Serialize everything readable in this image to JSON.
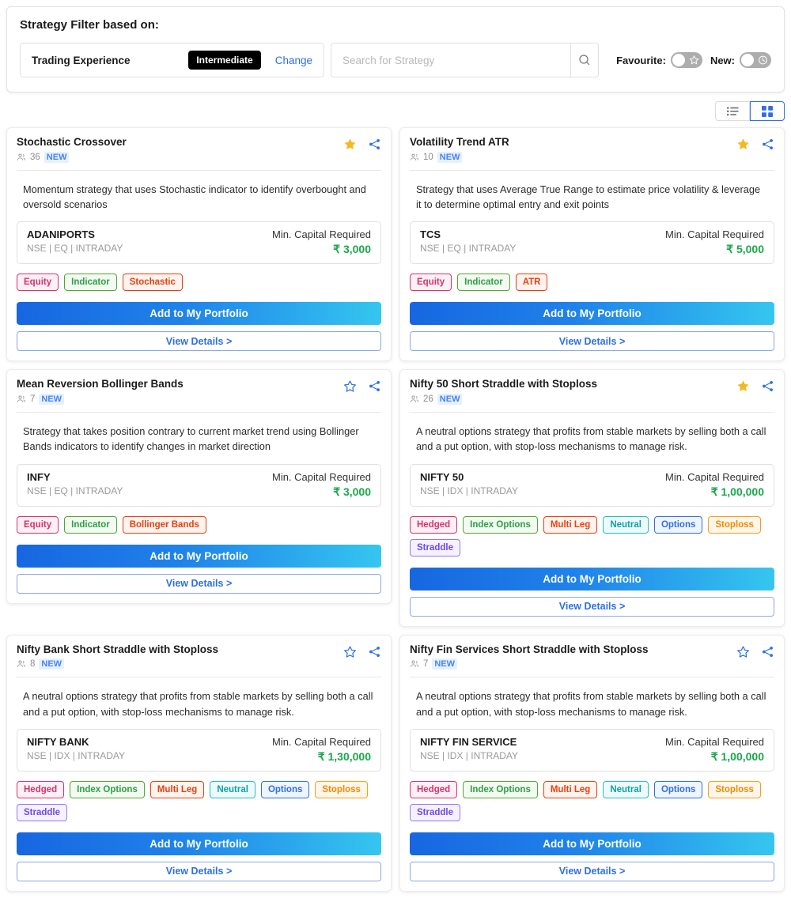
{
  "filter": {
    "title": "Strategy Filter based on:",
    "experience_label": "Trading Experience",
    "experience_value": "Intermediate",
    "change_link": "Change",
    "search_placeholder": "Search for Strategy",
    "search_value": "",
    "favourite_label": "Favourite:",
    "favourite_on": false,
    "new_label": "New:",
    "new_on": false
  },
  "view_toggle": {
    "list_label": "list-view",
    "grid_label": "grid-view",
    "active": "grid"
  },
  "labels": {
    "min_capital": "Min. Capital Required",
    "add_to_portfolio": "Add to My Portfolio",
    "view_details": "View Details >",
    "new_badge": "NEW"
  },
  "colors": {
    "accent_blue": "#2f6fe4",
    "green_value": "#1aa84a",
    "star_filled": "#f5b820",
    "gradient_start": "#1767e0",
    "gradient_end": "#35c6ef"
  },
  "cards": [
    {
      "title": "Stochastic Crossover",
      "users": "36",
      "new": "NEW",
      "favourite": true,
      "description": "Momentum strategy that uses Stochastic indicator to identify overbought and oversold scenarios",
      "instrument": "ADANIPORTS",
      "segment": "NSE | EQ | INTRADAY",
      "capital_label": "Min. Capital Required",
      "capital": "₹ 3,000",
      "tags": [
        {
          "label": "Equity",
          "color": "pink"
        },
        {
          "label": "Indicator",
          "color": "green"
        },
        {
          "label": "Stochastic",
          "color": "red"
        }
      ]
    },
    {
      "title": "Volatility Trend ATR",
      "users": "10",
      "new": "NEW",
      "favourite": true,
      "description": "Strategy that uses Average True Range to estimate price volatility & leverage it to determine optimal entry and exit points",
      "instrument": "TCS",
      "segment": "NSE | EQ | INTRADAY",
      "capital_label": "Min. Capital Required",
      "capital": "₹ 5,000",
      "tags": [
        {
          "label": "Equity",
          "color": "pink"
        },
        {
          "label": "Indicator",
          "color": "green"
        },
        {
          "label": "ATR",
          "color": "red"
        }
      ]
    },
    {
      "title": "Mean Reversion Bollinger Bands",
      "users": "7",
      "new": "NEW",
      "favourite": false,
      "description": "Strategy that takes position contrary to current market trend using Bollinger Bands indicators to identify changes in market direction",
      "instrument": "INFY",
      "segment": "NSE | EQ | INTRADAY",
      "capital_label": "Min. Capital Required",
      "capital": "₹ 3,000",
      "tags": [
        {
          "label": "Equity",
          "color": "pink"
        },
        {
          "label": "Indicator",
          "color": "green"
        },
        {
          "label": "Bollinger Bands",
          "color": "red"
        }
      ]
    },
    {
      "title": "Nifty 50 Short Straddle with Stoploss",
      "users": "26",
      "new": "NEW",
      "favourite": true,
      "description": "A neutral options strategy that profits from stable markets by selling both a call and a put option, with stop-loss mechanisms to manage risk.",
      "instrument": "NIFTY 50",
      "segment": "NSE | IDX | INTRADAY",
      "capital_label": "Min. Capital Required",
      "capital": "₹ 1,00,000",
      "tags": [
        {
          "label": "Hedged",
          "color": "pink"
        },
        {
          "label": "Index Options",
          "color": "green"
        },
        {
          "label": "Multi Leg",
          "color": "red"
        },
        {
          "label": "Neutral",
          "color": "teal"
        },
        {
          "label": "Options",
          "color": "blue"
        },
        {
          "label": "Stoploss",
          "color": "orange"
        },
        {
          "label": "Straddle",
          "color": "purple"
        }
      ]
    },
    {
      "title": "Nifty Bank Short Straddle with Stoploss",
      "users": "8",
      "new": "NEW",
      "favourite": false,
      "description": "A neutral options strategy that profits from stable markets by selling both a call and a put option, with stop-loss mechanisms to manage risk.",
      "instrument": "NIFTY BANK",
      "segment": "NSE | IDX | INTRADAY",
      "capital_label": "Min. Capital Required",
      "capital": "₹ 1,30,000",
      "tags": [
        {
          "label": "Hedged",
          "color": "pink"
        },
        {
          "label": "Index Options",
          "color": "green"
        },
        {
          "label": "Multi Leg",
          "color": "red"
        },
        {
          "label": "Neutral",
          "color": "teal"
        },
        {
          "label": "Options",
          "color": "blue"
        },
        {
          "label": "Stoploss",
          "color": "orange"
        },
        {
          "label": "Straddle",
          "color": "purple"
        }
      ]
    },
    {
      "title": "Nifty Fin Services Short Straddle with Stoploss",
      "users": "7",
      "new": "NEW",
      "favourite": false,
      "description": "A neutral options strategy that profits from stable markets by selling both a call and a put option, with stop-loss mechanisms to manage risk.",
      "instrument": "NIFTY FIN SERVICE",
      "segment": "NSE | IDX | INTRADAY",
      "capital_label": "Min. Capital Required",
      "capital": "₹ 1,00,000",
      "tags": [
        {
          "label": "Hedged",
          "color": "pink"
        },
        {
          "label": "Index Options",
          "color": "green"
        },
        {
          "label": "Multi Leg",
          "color": "red"
        },
        {
          "label": "Neutral",
          "color": "teal"
        },
        {
          "label": "Options",
          "color": "blue"
        },
        {
          "label": "Stoploss",
          "color": "orange"
        },
        {
          "label": "Straddle",
          "color": "purple"
        }
      ]
    }
  ]
}
